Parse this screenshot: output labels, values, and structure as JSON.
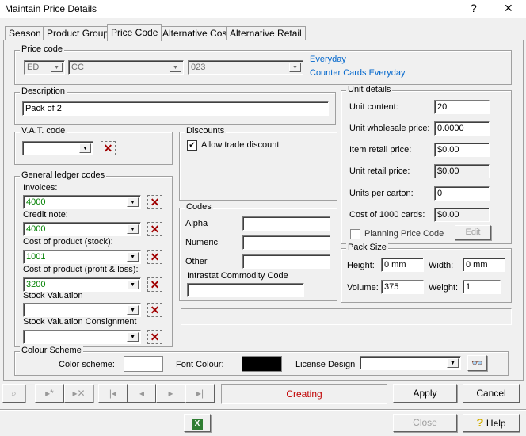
{
  "window": {
    "title": "Maintain Price Details",
    "help": "?",
    "close": "✕"
  },
  "tabs": [
    "Season",
    "Product Group",
    "Price Code",
    "Alternative Cost",
    "Alternative Retail"
  ],
  "price_code": {
    "legend": "Price code",
    "season": "ED",
    "group": "CC",
    "code": "023",
    "season_desc": "Everyday",
    "group_desc": "Counter Cards Everyday"
  },
  "description": {
    "legend": "Description",
    "value": "Pack of 2"
  },
  "vat": {
    "legend": "V.A.T. code",
    "value": ""
  },
  "discounts": {
    "legend": "Discounts",
    "allow_trade": "Allow trade discount",
    "allow_trade_checked": true
  },
  "gl": {
    "legend": "General ledger codes",
    "items": [
      {
        "label": "Invoices:",
        "value": "4000"
      },
      {
        "label": "Credit note:",
        "value": "4000"
      },
      {
        "label": "Cost of product (stock):",
        "value": "1001"
      },
      {
        "label": "Cost of product (profit & loss):",
        "value": "3200"
      },
      {
        "label": "Stock Valuation",
        "value": ""
      },
      {
        "label": "Stock Valuation Consignment",
        "value": ""
      }
    ]
  },
  "codes": {
    "legend": "Codes",
    "alpha": "Alpha",
    "numeric": "Numeric",
    "other": "Other",
    "intrastat": "Intrastat Commodity Code",
    "alpha_value": "",
    "numeric_value": "",
    "other_value": "",
    "intrastat_value": ""
  },
  "unit": {
    "legend": "Unit details",
    "rows": [
      {
        "label": "Unit content:",
        "value": "20",
        "disabled": false
      },
      {
        "label": "Unit wholesale price:",
        "value": "0.0000",
        "disabled": false
      },
      {
        "label": "Item retail price:",
        "value": "$0.00",
        "disabled": false
      },
      {
        "label": "Unit retail price:",
        "value": "$0.00",
        "disabled": true
      },
      {
        "label": "Units per carton:",
        "value": "0",
        "disabled": false
      },
      {
        "label": "Cost of 1000 cards:",
        "value": "$0.00",
        "disabled": true
      }
    ],
    "planning": "Planning Price Code",
    "edit": "Edit"
  },
  "pack": {
    "legend": "Pack Size",
    "height_label": "Height:",
    "height": "0 mm",
    "width_label": "Width:",
    "width": "0 mm",
    "volume_label": "Volume:",
    "volume": "375",
    "weight_label": "Weight:",
    "weight": "1"
  },
  "colour": {
    "legend": "Colour Scheme",
    "scheme_label": "Color scheme:",
    "font_label": "Font Colour:",
    "license_label": "License Design",
    "license_value": "",
    "font_colour": "#000000",
    "scheme_colour": "#ffffff"
  },
  "status": "Creating",
  "buttons": {
    "apply": "Apply",
    "cancel": "Cancel",
    "close": "Close",
    "help": "Help"
  },
  "colors": {
    "status": "#c00000",
    "link": "#0066cc",
    "gl_value": "#008000"
  }
}
